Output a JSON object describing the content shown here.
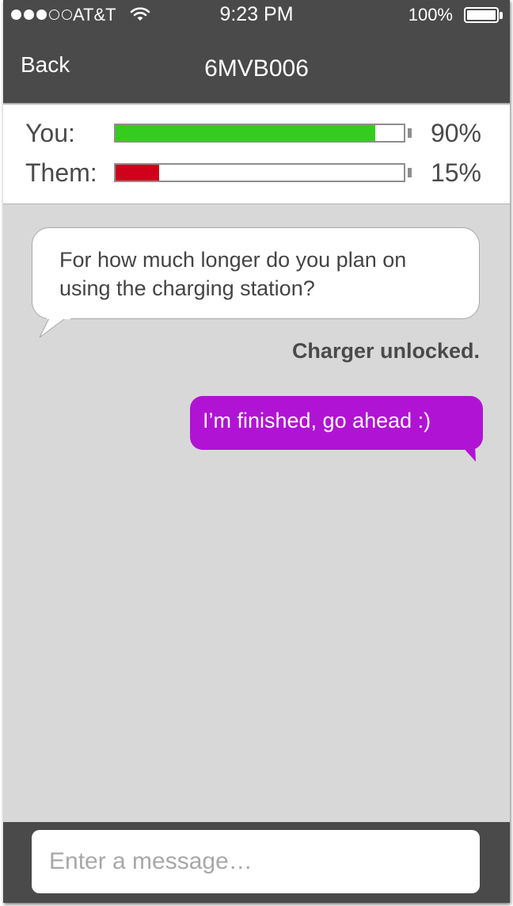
{
  "status_bar": {
    "signal_full": 3,
    "signal_total": 5,
    "carrier": "AT&T",
    "wifi_icon": "wifi-icon",
    "time": "9:23 PM",
    "battery_percent": "100%",
    "battery_level": 1.0
  },
  "nav": {
    "back_label": "Back",
    "title": "6MVB006"
  },
  "charge_levels": [
    {
      "label": "You:",
      "percent_text": "90%",
      "value": 0.9,
      "color": "#33cc1f"
    },
    {
      "label": "Them:",
      "percent_text": "15%",
      "value": 0.15,
      "color": "#d0021b"
    }
  ],
  "messages": {
    "incoming": "For how much longer do you plan on using the charging station?",
    "status": "Charger unlocked.",
    "outgoing": "I’m finished, go ahead :)"
  },
  "composer": {
    "placeholder": "Enter a message…"
  },
  "colors": {
    "bar_background": "#4a4a4a",
    "chat_background": "#d8d8d8",
    "outgoing_bubble": "#b113d4"
  }
}
